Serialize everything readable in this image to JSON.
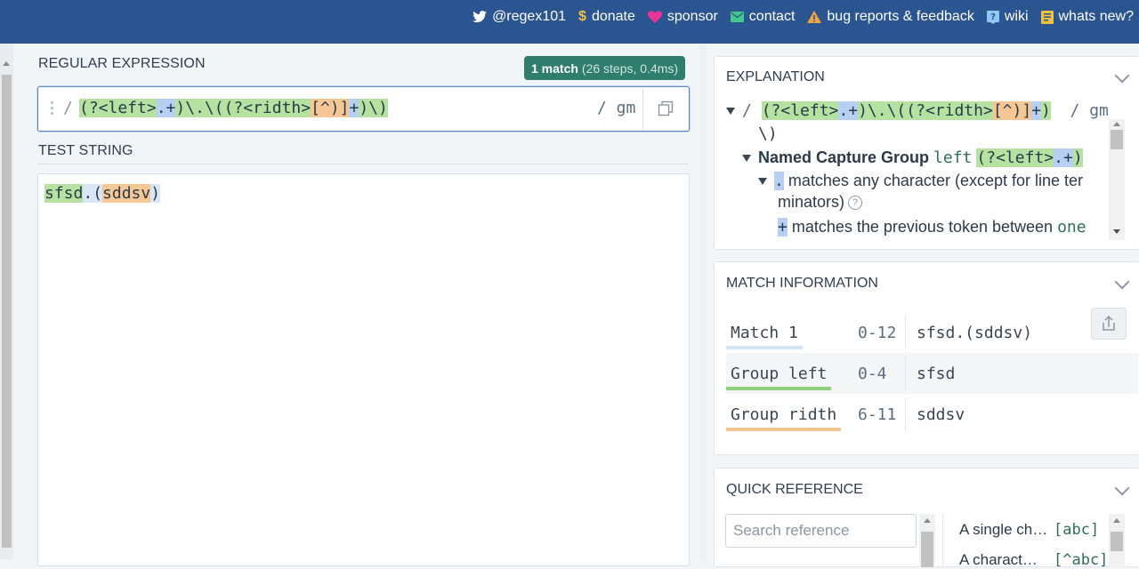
{
  "colors": {
    "topbar": "#2a5591",
    "match_badge": "#2e7d6d",
    "group_left": "#b5e2a0",
    "group_ridth": "#f4c795",
    "token": "#b8cff4",
    "match_line": "#d8e6f6"
  },
  "topnav": [
    {
      "icon": "twitter-icon",
      "label": "@regex101"
    },
    {
      "icon": "dollar-icon",
      "label": "donate"
    },
    {
      "icon": "heart-icon",
      "label": "sponsor"
    },
    {
      "icon": "mail-icon",
      "label": "contact"
    },
    {
      "icon": "warning-icon",
      "label": "bug reports & feedback"
    },
    {
      "icon": "help-book-icon",
      "label": "wiki"
    },
    {
      "icon": "news-icon",
      "label": "whats new?"
    }
  ],
  "regex": {
    "section_title": "REGULAR EXPRESSION",
    "match_badge": {
      "count": "1 match",
      "details": "(26 steps, 0.4ms)"
    },
    "delimiter": "/",
    "pattern_parts": [
      "(?<left>",
      ".+",
      ")\\.\\(",
      "(?<ridth>",
      "[^)]",
      "+",
      ")\\)"
    ],
    "flags": "/ gm"
  },
  "test_string": {
    "section_title": "TEST STRING",
    "parts": [
      "sfsd",
      ".(",
      "sddsv",
      ")"
    ]
  },
  "explanation": {
    "title": "EXPLANATION",
    "line1": {
      "slash": "/",
      "parts": [
        "(?<left>",
        ".+",
        ")\\.\\(",
        "(?<ridth>",
        "[^)]",
        "+",
        ")"
      ],
      "flags": "/ gm",
      "wrap": "\\)"
    },
    "line2": {
      "label": "Named Capture Group",
      "name": "left",
      "code_a": "(?<left>",
      "code_b": ".+",
      "code_c": ")"
    },
    "line3": {
      "token": ".",
      "text": "matches any character (except for line ter"
    },
    "line4": {
      "text": "minators)",
      "help": "?"
    },
    "line5": {
      "token": "+",
      "text": "matches the previous token between",
      "code": "one"
    }
  },
  "match_info": {
    "title": "MATCH INFORMATION",
    "rows": [
      {
        "name": "Match 1",
        "range": "0-12",
        "value": "sfsd.(sddsv)"
      },
      {
        "name": "Group left",
        "range": "0-4",
        "value": "sfsd"
      },
      {
        "name": "Group ridth",
        "range": "6-11",
        "value": "sddsv"
      }
    ]
  },
  "quick_reference": {
    "title": "QUICK REFERENCE",
    "search_placeholder": "Search reference",
    "items": [
      {
        "label": "A single ch…",
        "code": "[abc]"
      },
      {
        "label": "A charact…",
        "code": "[^abc]"
      }
    ]
  }
}
